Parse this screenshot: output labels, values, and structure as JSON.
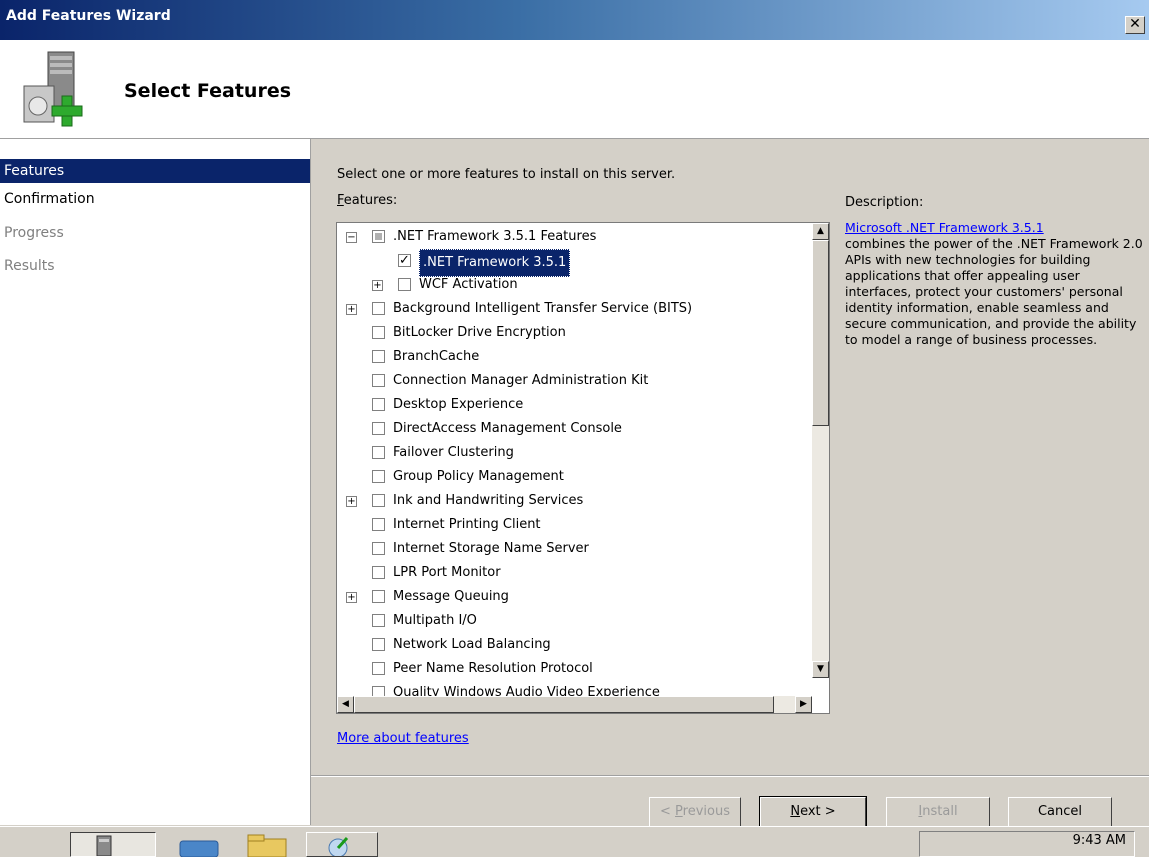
{
  "window": {
    "title": "Add Features Wizard",
    "close_glyph": "✕"
  },
  "header": {
    "heading": "Select Features",
    "icon": "server-add-icon"
  },
  "nav": {
    "items": [
      {
        "label": "Features",
        "state": "selected"
      },
      {
        "label": "Confirmation",
        "state": "enabled"
      },
      {
        "label": "Progress",
        "state": "disabled"
      },
      {
        "label": "Results",
        "state": "disabled"
      }
    ]
  },
  "main": {
    "prompt": "Select one or more features to install on this server.",
    "features_label_prefix": "F",
    "features_label_rest": "eatures:",
    "tree": [
      {
        "label": ".NET Framework 3.5.1 Features",
        "level": 0,
        "expander": "−",
        "checked": "partial"
      },
      {
        "label": ".NET Framework 3.5.1",
        "level": 1,
        "expander": "",
        "checked": "checked",
        "selected": true
      },
      {
        "label": "WCF Activation",
        "level": 1,
        "expander": "+",
        "checked": "unchecked"
      },
      {
        "label": "Background Intelligent Transfer Service (BITS)",
        "level": 0,
        "expander": "+",
        "checked": "unchecked"
      },
      {
        "label": "BitLocker Drive Encryption",
        "level": 0,
        "expander": "",
        "checked": "unchecked"
      },
      {
        "label": "BranchCache",
        "level": 0,
        "expander": "",
        "checked": "unchecked"
      },
      {
        "label": "Connection Manager Administration Kit",
        "level": 0,
        "expander": "",
        "checked": "unchecked"
      },
      {
        "label": "Desktop Experience",
        "level": 0,
        "expander": "",
        "checked": "unchecked"
      },
      {
        "label": "DirectAccess Management Console",
        "level": 0,
        "expander": "",
        "checked": "unchecked"
      },
      {
        "label": "Failover Clustering",
        "level": 0,
        "expander": "",
        "checked": "unchecked"
      },
      {
        "label": "Group Policy Management",
        "level": 0,
        "expander": "",
        "checked": "unchecked"
      },
      {
        "label": "Ink and Handwriting Services",
        "level": 0,
        "expander": "+",
        "checked": "unchecked"
      },
      {
        "label": "Internet Printing Client",
        "level": 0,
        "expander": "",
        "checked": "unchecked"
      },
      {
        "label": "Internet Storage Name Server",
        "level": 0,
        "expander": "",
        "checked": "unchecked"
      },
      {
        "label": "LPR Port Monitor",
        "level": 0,
        "expander": "",
        "checked": "unchecked"
      },
      {
        "label": "Message Queuing",
        "level": 0,
        "expander": "+",
        "checked": "unchecked"
      },
      {
        "label": "Multipath I/O",
        "level": 0,
        "expander": "",
        "checked": "unchecked"
      },
      {
        "label": "Network Load Balancing",
        "level": 0,
        "expander": "",
        "checked": "unchecked"
      },
      {
        "label": "Peer Name Resolution Protocol",
        "level": 0,
        "expander": "",
        "checked": "unchecked"
      },
      {
        "label": "Quality Windows Audio Video Experience",
        "level": 0,
        "expander": "",
        "checked": "unchecked"
      }
    ],
    "description_label": "Description:",
    "description_link": "Microsoft .NET Framework 3.5.1",
    "description_text": "combines the power of the .NET Framework 2.0 APIs with new technologies for building applications that offer appealing user interfaces, protect your customers' personal identity information, enable seamless and secure communication, and provide the ability to model a range of business processes.",
    "more_link": "More about features"
  },
  "buttons": {
    "previous_prefix": "< ",
    "previous_key": "P",
    "previous_rest": "revious",
    "next_key": "N",
    "next_rest": "ext >",
    "install_key": "I",
    "install_rest": "nstall",
    "cancel": "Cancel"
  },
  "taskbar": {
    "clock": "9:43 AM"
  },
  "colors": {
    "selection": "#0a246a",
    "link": "#0000ff",
    "face": "#d4d0c8"
  }
}
